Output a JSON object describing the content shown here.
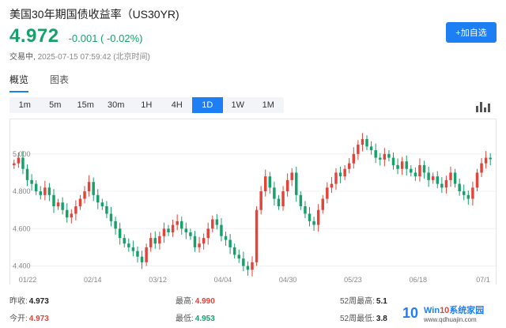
{
  "header": {
    "title": "美国30年期国债收益率（US30YR)",
    "price": "4.972",
    "change": "-0.001 ( -0.02%)",
    "status_label": "交易中,",
    "timestamp": "2025-07-15 07:59:42",
    "timezone": "(北京时间)",
    "watch_button": "+加自选"
  },
  "tabs": [
    {
      "label": "概览",
      "active": true
    },
    {
      "label": "图表",
      "active": false
    }
  ],
  "timeframes": [
    {
      "label": "1m",
      "active": false
    },
    {
      "label": "5m",
      "active": false
    },
    {
      "label": "15m",
      "active": false
    },
    {
      "label": "30m",
      "active": false
    },
    {
      "label": "1H",
      "active": false
    },
    {
      "label": "4H",
      "active": false
    },
    {
      "label": "1D",
      "active": true
    },
    {
      "label": "1W",
      "active": false
    },
    {
      "label": "1M",
      "active": false
    }
  ],
  "chart_data": {
    "type": "candlestick",
    "x_ticks": [
      "01/22",
      "02/14",
      "03/12",
      "04/04",
      "04/30",
      "05/23",
      "06/18",
      "07/1"
    ],
    "y_ticks": [
      "5.000",
      "4.800",
      "4.600",
      "4.400"
    ],
    "ylim": [
      4.36,
      5.16
    ],
    "colors": {
      "up": "#e0443b",
      "down": "#17a06a"
    },
    "closes": [
      4.95,
      4.98,
      4.92,
      4.86,
      4.84,
      4.8,
      4.78,
      4.82,
      4.78,
      4.72,
      4.74,
      4.7,
      4.66,
      4.68,
      4.72,
      4.76,
      4.8,
      4.85,
      4.78,
      4.74,
      4.72,
      4.68,
      4.64,
      4.6,
      4.55,
      4.52,
      4.5,
      4.48,
      4.45,
      4.42,
      4.5,
      4.55,
      4.52,
      4.56,
      4.6,
      4.58,
      4.62,
      4.64,
      4.6,
      4.58,
      4.56,
      4.5,
      4.52,
      4.55,
      4.6,
      4.65,
      4.62,
      4.56,
      4.54,
      4.5,
      4.46,
      4.44,
      4.4,
      4.38,
      4.42,
      4.7,
      4.8,
      4.88,
      4.82,
      4.76,
      4.72,
      4.8,
      4.86,
      4.9,
      4.78,
      4.72,
      4.68,
      4.64,
      4.62,
      4.7,
      4.76,
      4.82,
      4.84,
      4.9,
      4.88,
      4.92,
      4.95,
      5.0,
      5.05,
      5.08,
      5.04,
      5.02,
      4.98,
      4.97,
      5.0,
      4.98,
      4.94,
      4.92,
      4.96,
      4.92,
      4.9,
      4.88,
      4.94,
      4.9,
      4.86,
      4.88,
      4.84,
      4.82,
      4.86,
      4.9,
      4.84,
      4.8,
      4.78,
      4.76,
      4.82,
      4.9,
      4.95,
      4.98,
      4.972
    ]
  },
  "stats": [
    {
      "label": "昨收:",
      "value": "4.973",
      "tone": "dark"
    },
    {
      "label": "最高:",
      "value": "4.990",
      "tone": "red"
    },
    {
      "label": "52周最高:",
      "value": "5.1",
      "tone": "dark"
    },
    {
      "label": "今开:",
      "value": "4.973",
      "tone": "red"
    },
    {
      "label": "最低:",
      "value": "4.953",
      "tone": "green"
    },
    {
      "label": "52周最低:",
      "value": "3.8",
      "tone": "dark"
    }
  ],
  "watermark": {
    "logo": "10",
    "title_a": "Win",
    "title_b": "10",
    "title_c": "系统家园",
    "url": "www.qdhuajin.com"
  }
}
